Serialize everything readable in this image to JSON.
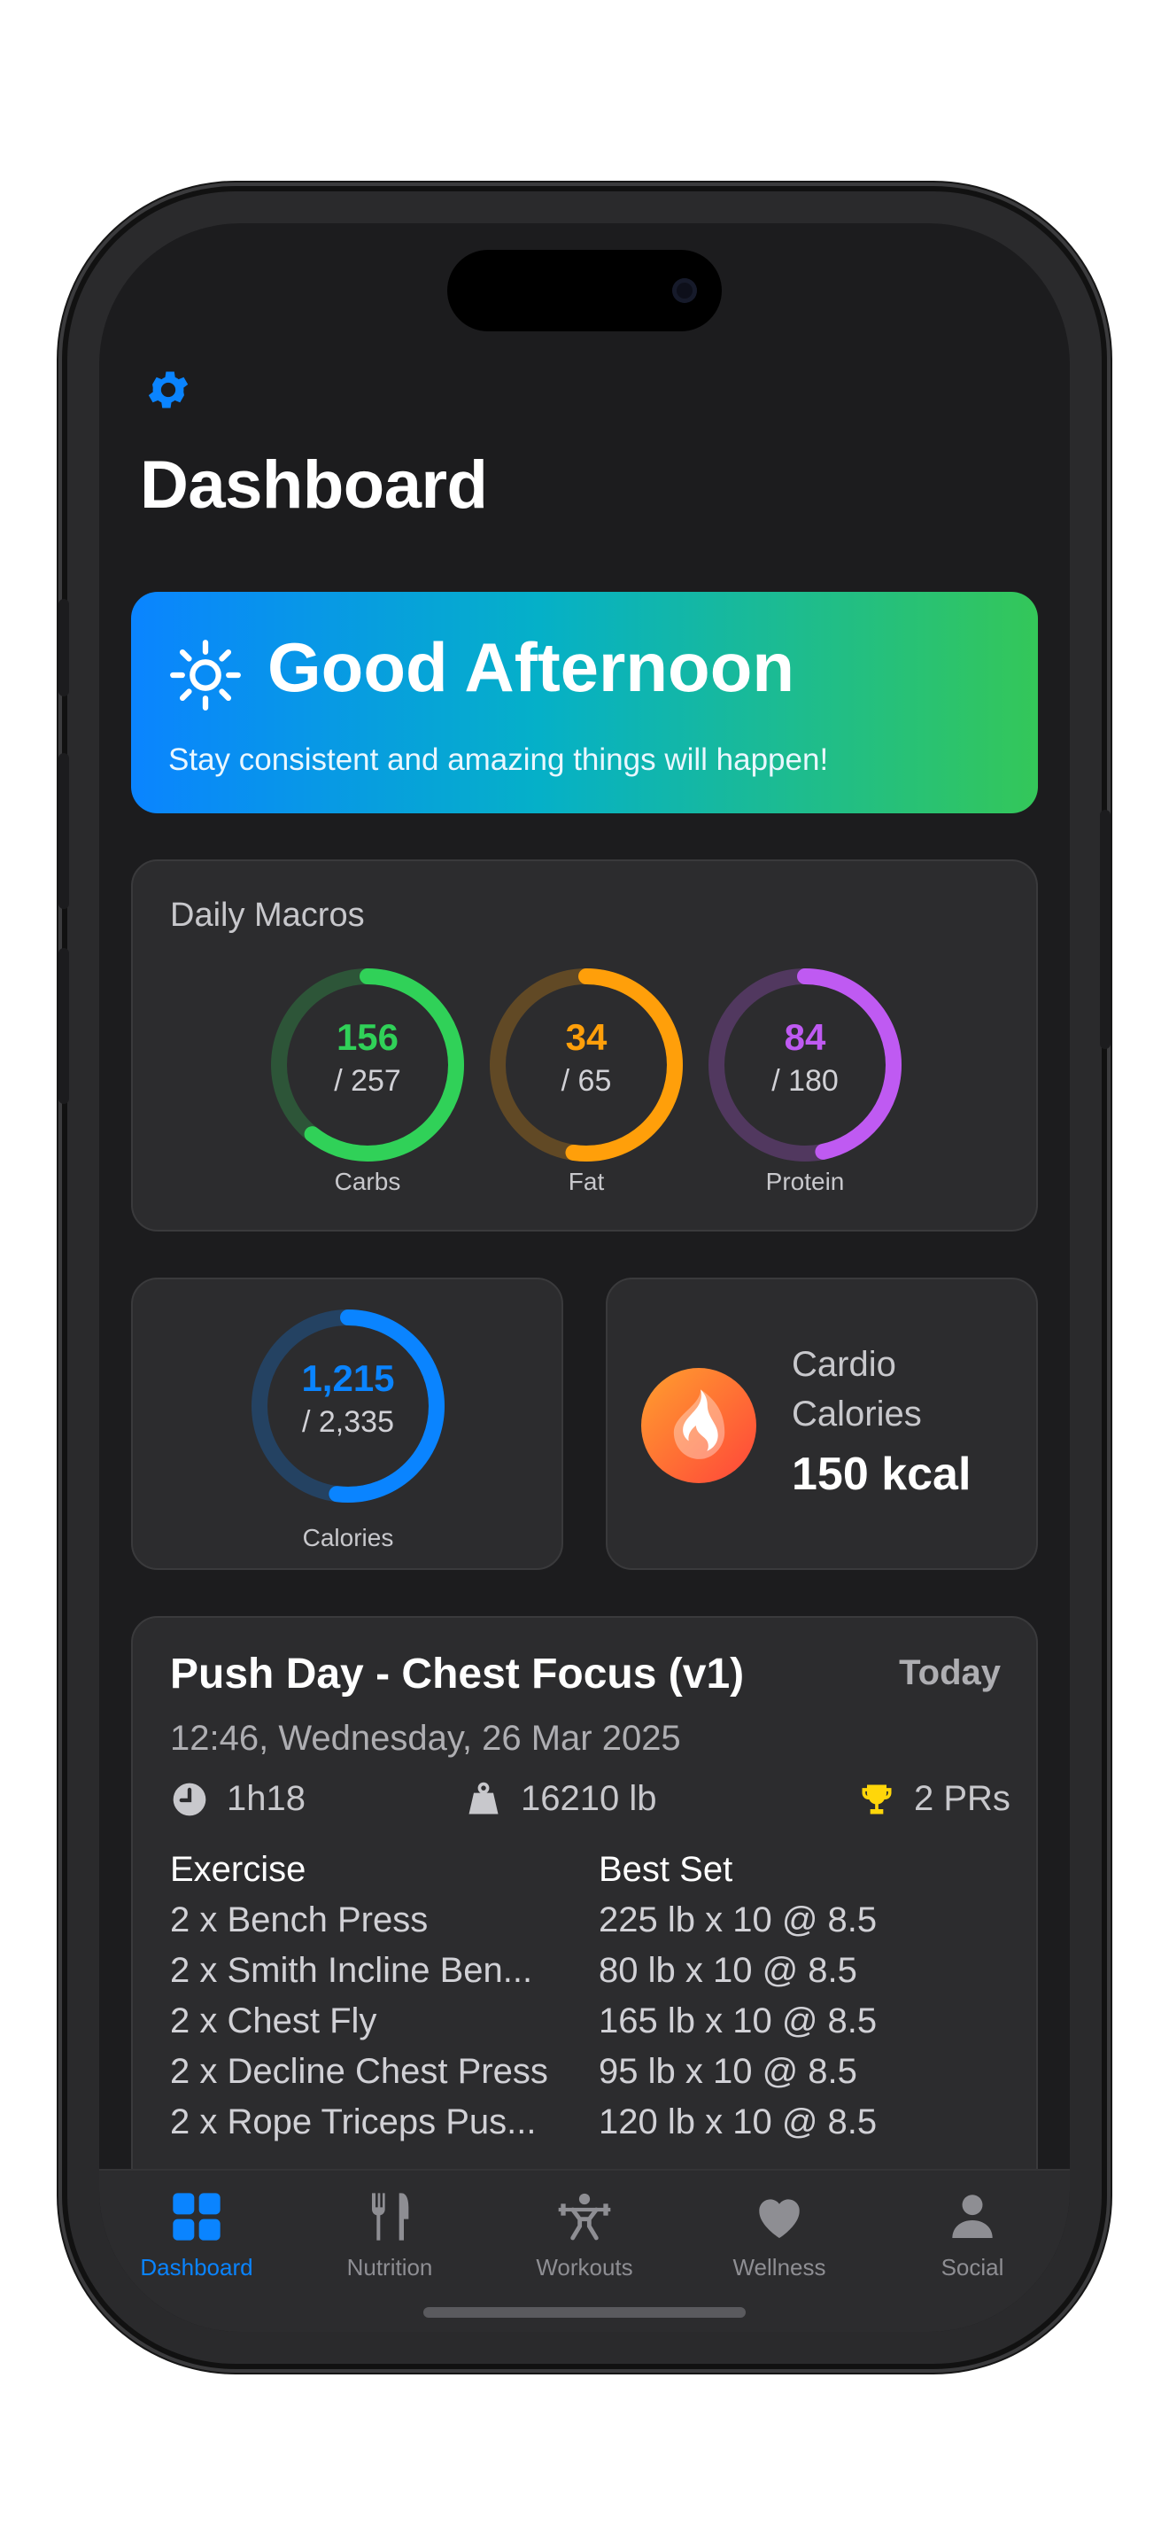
{
  "header": {
    "title": "Dashboard"
  },
  "greeting": {
    "title": "Good Afternoon",
    "subtitle": "Stay consistent and amazing things will happen!"
  },
  "macros": {
    "label": "Daily Macros",
    "items": [
      {
        "name": "Carbs",
        "value": "156",
        "goal": "/ 257",
        "fraction": 0.607,
        "color": "#30d158"
      },
      {
        "name": "Fat",
        "value": "34",
        "goal": "/ 65",
        "fraction": 0.523,
        "color": "#ff9f0a"
      },
      {
        "name": "Protein",
        "value": "84",
        "goal": "/ 180",
        "fraction": 0.467,
        "color": "#bf5af2"
      }
    ]
  },
  "calories": {
    "name": "Calories",
    "value": "1,215",
    "goal": "/ 2,335",
    "fraction": 0.52,
    "color": "#0a84ff"
  },
  "cardio": {
    "line1": "Cardio",
    "line2": "Calories",
    "value": "150 kcal"
  },
  "workout": {
    "title": "Push Day - Chest Focus (v1)",
    "badge": "Today",
    "datetime": "12:46, Wednesday, 26 Mar 2025",
    "duration": "1h18",
    "volume": "16210 lb",
    "prs": "2 PRs",
    "col_exercise": "Exercise",
    "col_best": "Best Set",
    "rows": [
      {
        "exercise": "2 x Bench Press",
        "best": "225 lb x 10 @ 8.5"
      },
      {
        "exercise": "2 x Smith Incline Ben...",
        "best": "80 lb x 10 @ 8.5"
      },
      {
        "exercise": "2 x Chest Fly",
        "best": "165 lb x 10 @ 8.5"
      },
      {
        "exercise": "2 x Decline Chest Press",
        "best": "95 lb x 10 @ 8.5"
      },
      {
        "exercise": "2 x Rope Triceps Pus...",
        "best": "120 lb x 10 @ 8.5"
      }
    ]
  },
  "tabs": [
    {
      "label": "Dashboard",
      "icon": "grid-icon",
      "active": true
    },
    {
      "label": "Nutrition",
      "icon": "fork-knife-icon",
      "active": false
    },
    {
      "label": "Workouts",
      "icon": "weightlifter-icon",
      "active": false
    },
    {
      "label": "Wellness",
      "icon": "heart-icon",
      "active": false
    },
    {
      "label": "Social",
      "icon": "person-icon",
      "active": false
    }
  ],
  "colors": {
    "accent": "#0a84ff",
    "background": "#1c1c1e",
    "card": "#2c2c2e",
    "trophy": "#ffd60a"
  }
}
